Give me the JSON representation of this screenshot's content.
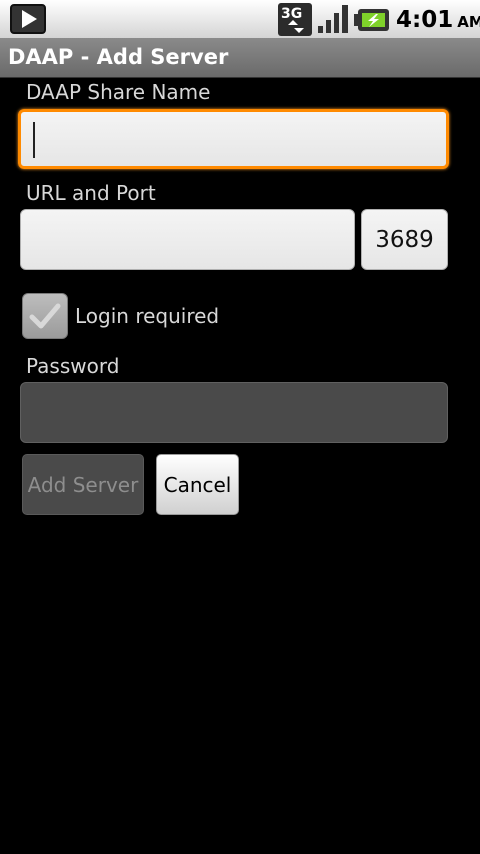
{
  "status_bar": {
    "network": "3G",
    "time": "4:01",
    "ampm": "AM",
    "icons": [
      "play-icon",
      "network-3g-icon",
      "signal-icon",
      "battery-charging-icon"
    ]
  },
  "title": "DAAP - Add Server",
  "form": {
    "share_name_label": "DAAP Share Name",
    "share_name_value": "",
    "url_label": "URL and Port",
    "url_value": "",
    "port_value": "3689",
    "login_required_label": "Login required",
    "login_required_checked": true,
    "password_label": "Password",
    "password_value": ""
  },
  "buttons": {
    "add_server": "Add Server",
    "cancel": "Cancel"
  },
  "colors": {
    "focus_border": "#ff8a00",
    "background": "#000000"
  }
}
